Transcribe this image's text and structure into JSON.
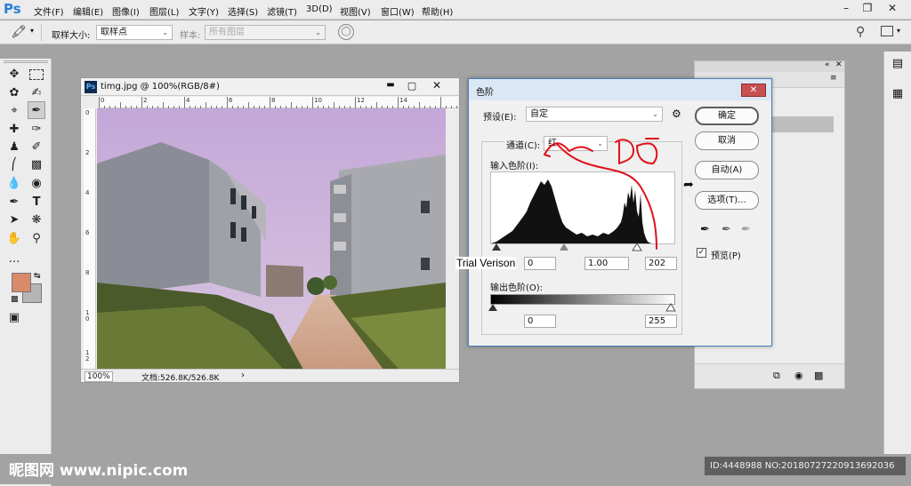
{
  "menubar": {
    "items": [
      "文件(F)",
      "编辑(E)",
      "图像(I)",
      "图层(L)",
      "文字(Y)",
      "选择(S)",
      "滤镜(T)",
      "3D(D)",
      "视图(V)",
      "窗口(W)",
      "帮助(H)"
    ]
  },
  "options": {
    "sample_size_label": "取样大小:",
    "sample_size_value": "取样点",
    "sample_label": "样本:",
    "sample_value": "所有图层"
  },
  "document": {
    "title": "timg.jpg @ 100%(RGB/8#)",
    "zoom": "100%",
    "doc_info": "文档:526.8K/526.8K",
    "ruler_top": [
      "0",
      "2",
      "4",
      "6",
      "8",
      "10",
      "12",
      "14"
    ],
    "ruler_left": [
      "0",
      "2",
      "4",
      "6",
      "8",
      "1 0",
      "1 2"
    ]
  },
  "levels": {
    "title": "色阶",
    "preset_label": "预设(E):",
    "preset_value": "自定",
    "channel_label": "通道(C):",
    "channel_value": "红",
    "input_label": "输入色阶(I):",
    "input_black": "0",
    "input_gamma": "1.00",
    "input_white": "202",
    "output_label": "输出色阶(O):",
    "output_black": "0",
    "output_white": "255",
    "ok": "确定",
    "cancel": "取消",
    "auto": "自动(A)",
    "options_btn": "选项(T)...",
    "preview": "预览(P)",
    "preview_checked": true
  },
  "overlay": {
    "trial_text": "Trial Verison",
    "watermark_left": "昵图网 www.nipic.com",
    "watermark_right": "ID:4448988 NO:20180727220913692036"
  },
  "colors": {
    "foreground": "#d98a6a",
    "background": "#b5b5b5",
    "annotation": "#e0101a"
  }
}
